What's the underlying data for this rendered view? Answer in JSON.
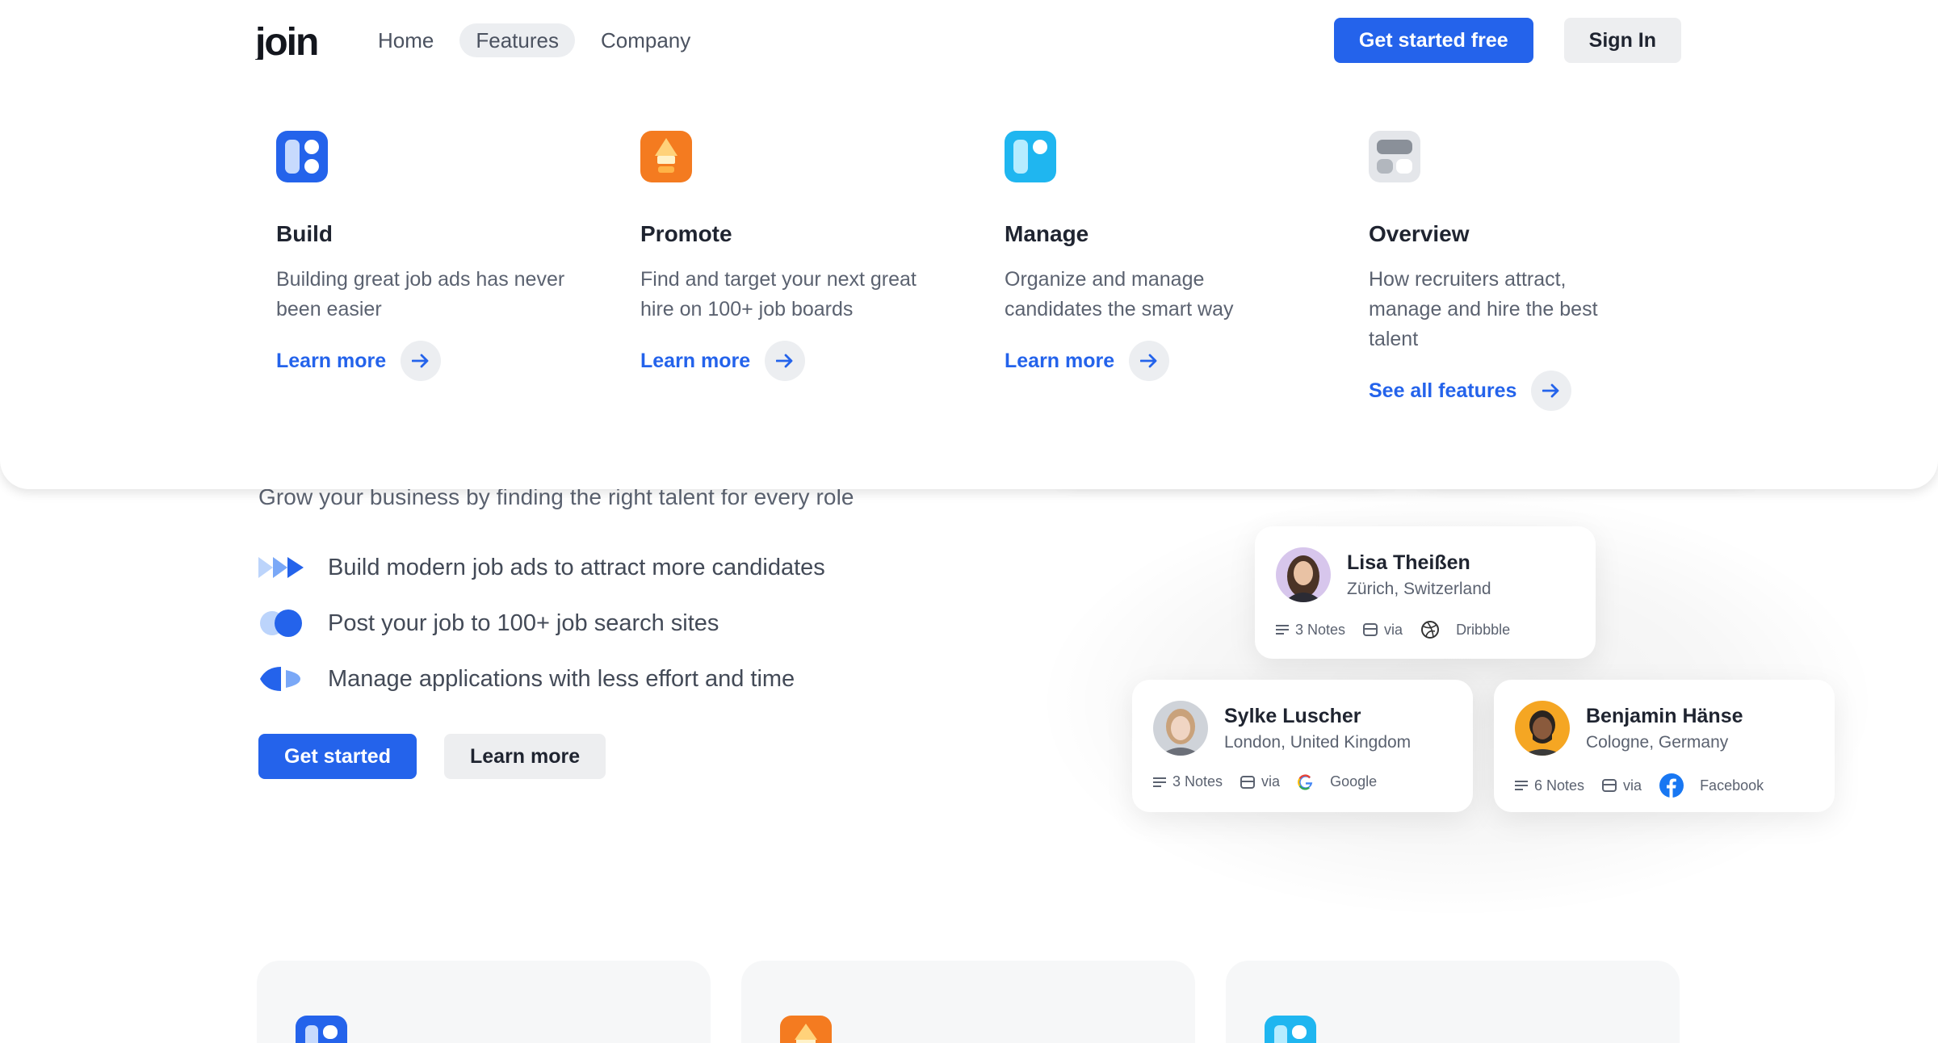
{
  "brand": {
    "logo_text": "join",
    "accent": "#2463eb"
  },
  "nav": {
    "links": [
      {
        "label": "Home",
        "active": false
      },
      {
        "label": "Features",
        "active": true
      },
      {
        "label": "Company",
        "active": false
      }
    ],
    "cta_primary": "Get started free",
    "cta_secondary": "Sign In"
  },
  "features_menu": [
    {
      "title": "Build",
      "description": "Building great job ads has never been easier",
      "link": "Learn more",
      "icon": "build-icon"
    },
    {
      "title": "Promote",
      "description": "Find and target your next great hire on 100+ job boards",
      "link": "Learn more",
      "icon": "promote-icon"
    },
    {
      "title": "Manage",
      "description": "Organize and manage candidates the smart way",
      "link": "Learn more",
      "icon": "manage-icon"
    },
    {
      "title": "Overview",
      "description": "How recruiters attract, manage and hire the best talent",
      "link": "See all features",
      "icon": "overview-icon"
    }
  ],
  "hero": {
    "subtitle": "Grow your business by finding the right talent for every role",
    "bullets": [
      "Build modern job ads to attract more candidates",
      "Post your job to 100+ job search sites",
      "Manage applications with less effort and time"
    ],
    "cta_primary": "Get started",
    "cta_secondary": "Learn more"
  },
  "candidates": [
    {
      "name": "Lisa Theißen",
      "location": "Zürich, Switzerland",
      "notes": "3 Notes",
      "via": "via",
      "source": "Dribbble"
    },
    {
      "name": "Sylke Luscher",
      "location": "London, United Kingdom",
      "notes": "3 Notes",
      "via": "via",
      "source": "Google"
    },
    {
      "name": "Benjamin Hänse",
      "location": "Cologne, Germany",
      "notes": "6 Notes",
      "via": "via",
      "source": "Facebook"
    }
  ]
}
